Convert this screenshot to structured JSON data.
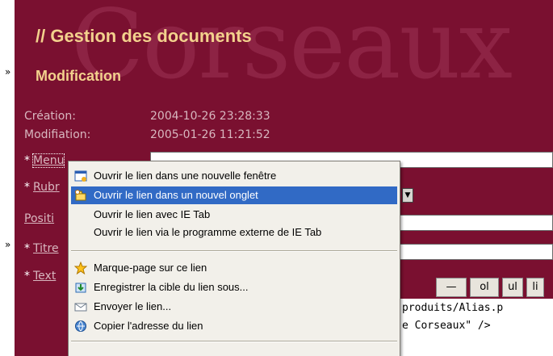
{
  "page": {
    "title": "// Gestion des documents",
    "subtitle": "Modification",
    "watermark": "Corseaux"
  },
  "fields": {
    "creation_label": "Création:",
    "creation_value": "2004-10-26 23:28:33",
    "modification_label": "Modifiation:",
    "modification_value": "2005-01-26 11:21:52",
    "menu_label": "Menu",
    "rubrique_label": "Rubr",
    "position_label": "Positi",
    "titre_label": "Titre",
    "texte_label": "Text",
    "required_marker": "*"
  },
  "toolbar": {
    "hr_label": "—",
    "ol_label": "ol",
    "ul_label": "ul",
    "li_label": "li"
  },
  "code": {
    "line1": "produits/Alias.p",
    "line2": "e Corseaux\" />"
  },
  "context_menu": {
    "items": [
      {
        "label": "Ouvrir le lien dans une nouvelle fenêtre",
        "icon": "new-window-icon"
      },
      {
        "label": "Ouvrir le lien dans un nouvel onglet",
        "icon": "new-tab-icon"
      },
      {
        "label": "Ouvrir le lien avec IE Tab",
        "icon": ""
      },
      {
        "label": "Ouvrir le lien via le programme externe de IE Tab",
        "icon": ""
      },
      {
        "label": "Marque-page sur ce lien",
        "icon": "bookmark-star-icon"
      },
      {
        "label": "Enregistrer la cible du lien sous...",
        "icon": "save-link-icon"
      },
      {
        "label": "Envoyer le lien...",
        "icon": "send-link-icon"
      },
      {
        "label": "Copier l'adresse du lien",
        "icon": "copy-link-icon"
      }
    ]
  },
  "colors": {
    "panel": "#7a1030",
    "heading": "#f3d18d",
    "label": "#d8b7bf",
    "selection": "#316ac5"
  }
}
